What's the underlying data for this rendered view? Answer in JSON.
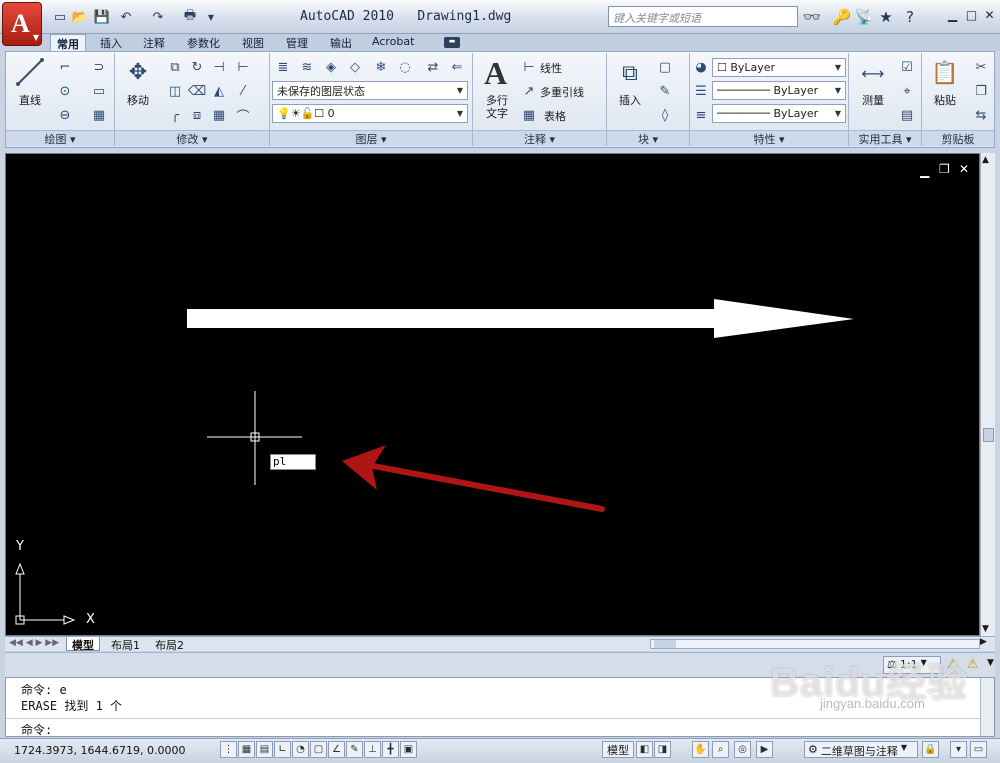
{
  "window": {
    "title": "AutoCAD 2010   Drawing1.dwg",
    "search_placeholder": "键入关键字或短语"
  },
  "tabs": [
    "常用",
    "插入",
    "注释",
    "参数化",
    "视图",
    "管理",
    "输出",
    "Acrobat"
  ],
  "ribbon": {
    "draw": {
      "line_label": "直线",
      "title": "绘图 ▾"
    },
    "modify": {
      "move_label": "移动",
      "title": "修改 ▾"
    },
    "layers": {
      "state_combo": "未保存的图层状态",
      "layer_combo": "0",
      "title": "图层 ▾"
    },
    "annotation": {
      "text_label_1": "多行",
      "text_label_2": "文字",
      "linear": "线性",
      "mleader": "多重引线",
      "table": "表格",
      "title": "注释 ▾"
    },
    "block": {
      "insert_label": "插入",
      "title": "块 ▾"
    },
    "properties": {
      "color": "ByLayer",
      "linetype": "ByLayer",
      "lineweight": "ByLayer",
      "title": "特性 ▾"
    },
    "utilities": {
      "measure_label": "测量",
      "title": "实用工具 ▾"
    },
    "clipboard": {
      "paste_label": "粘贴",
      "title": "剪贴板"
    }
  },
  "canvas": {
    "dynamic_input": "pl",
    "ucs_x": "X",
    "ucs_y": "Y"
  },
  "layout_tabs": [
    "模型",
    "布局1",
    "布局2"
  ],
  "annotation_scale": "1:1",
  "command": {
    "lines": [
      "命令: e",
      "ERASE 找到 1 个"
    ],
    "prompt": "命令:"
  },
  "status": {
    "coordinates": "1724.3973, 1644.6719, 0.0000",
    "model_label": "模型",
    "workspace": "二维草图与注释"
  },
  "watermark": {
    "brand": "Baidu经验",
    "url": "jingyan.baidu.com"
  }
}
